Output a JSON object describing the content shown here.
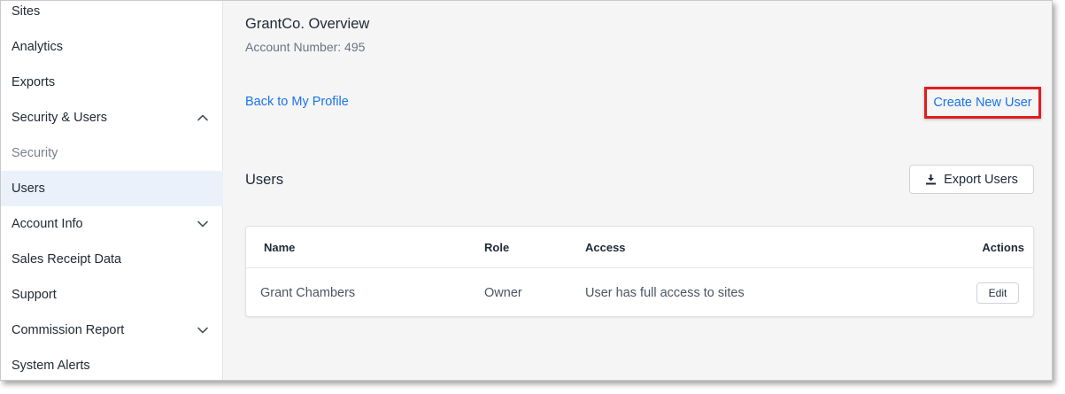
{
  "sidebar": {
    "items": [
      {
        "label": "Sites"
      },
      {
        "label": "Analytics"
      },
      {
        "label": "Exports"
      },
      {
        "label": "Security & Users",
        "expanded": true
      },
      {
        "label": "Security"
      },
      {
        "label": "Users",
        "selected": true
      },
      {
        "label": "Account Info",
        "expanded": false
      },
      {
        "label": "Sales Receipt Data"
      },
      {
        "label": "Support"
      },
      {
        "label": "Commission Report",
        "expanded": false
      },
      {
        "label": "System Alerts"
      }
    ]
  },
  "header": {
    "title": "GrantCo. Overview",
    "account_number": "Account Number: 495"
  },
  "links": {
    "back": "Back to My Profile",
    "create_user": "Create New User"
  },
  "users_section": {
    "heading": "Users",
    "export_label": "Export Users",
    "columns": [
      "Name",
      "Role",
      "Access",
      "Actions"
    ],
    "rows": [
      {
        "name": "Grant Chambers",
        "role": "Owner",
        "access": "User has full access to sites",
        "action": "Edit"
      }
    ]
  },
  "colors": {
    "link": "#1a73e8",
    "highlight_border": "#e01e1e",
    "active_item_bg": "#eaf1fb"
  },
  "icons": {
    "expand": "chevron-up-icon",
    "collapse": "chevron-down-icon",
    "export": "download-icon"
  }
}
